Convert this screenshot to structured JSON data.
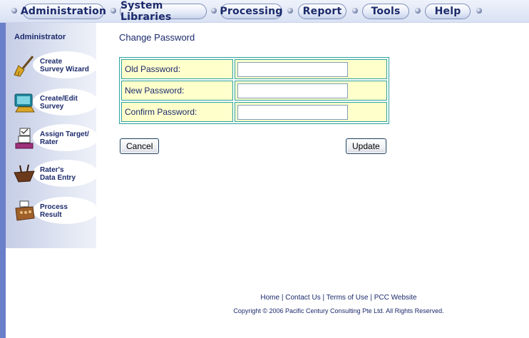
{
  "nav": {
    "tabs": [
      {
        "label": "Administration"
      },
      {
        "label": "System Libraries"
      },
      {
        "label": "Processing"
      },
      {
        "label": "Report"
      },
      {
        "label": "Tools"
      },
      {
        "label": "Help"
      }
    ]
  },
  "sidebar": {
    "title": "Administrator",
    "items": [
      {
        "label": "Create\nSurvey Wizard",
        "icon": "broom-icon"
      },
      {
        "label": "Create/Edit\nSurvey",
        "icon": "computer-icon"
      },
      {
        "label": "Assign Target/\nRater",
        "icon": "assign-icon"
      },
      {
        "label": "Rater's\nData Entry",
        "icon": "ship-icon"
      },
      {
        "label": "Process\nResult",
        "icon": "machine-icon"
      }
    ]
  },
  "main": {
    "title": "Change Password",
    "form": {
      "old_label": "Old Password:",
      "old_value": "",
      "new_label": "New Password:",
      "new_value": "",
      "confirm_label": "Confirm Password:",
      "confirm_value": ""
    },
    "cancel_label": "Cancel",
    "update_label": "Update"
  },
  "footer": {
    "home": "Home",
    "contact": "Contact Us",
    "terms": "Terms of Use",
    "website": "PCC Website",
    "separator": " | ",
    "copyright": "Copyright © 2006 Pacific Century Consulting Pte Ltd. All Rights Reserved."
  },
  "colors": {
    "nav_text": "#1b2a6b",
    "form_bg": "#ffffcc",
    "form_border": "#2aa39a",
    "sidebar_stripe": "#6a7fc9"
  }
}
